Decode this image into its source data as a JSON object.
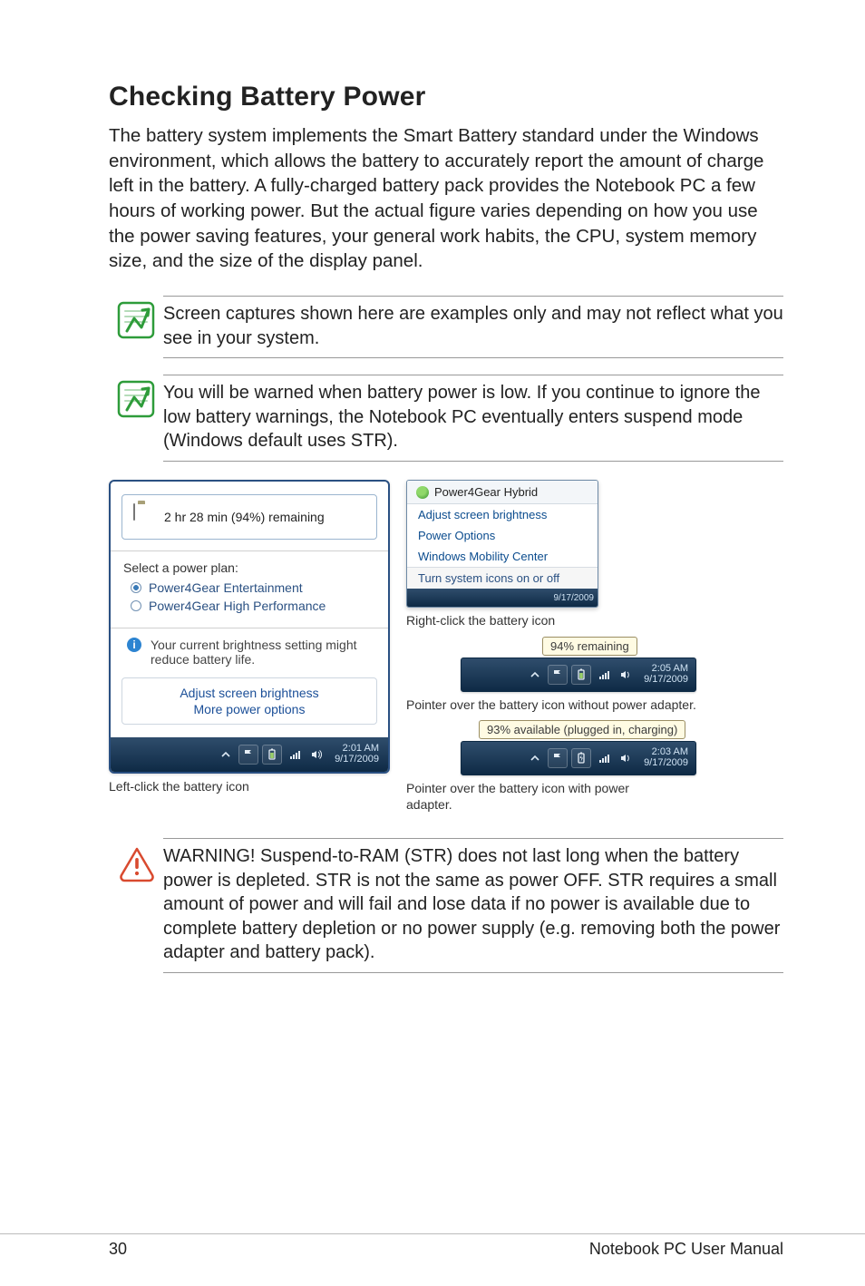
{
  "heading": "Checking Battery Power",
  "intro": "The battery system implements the Smart Battery standard under the Windows environment, which allows the battery to accurately report the amount of charge left in the battery. A fully-charged battery pack provides the Notebook PC a few hours of working power. But the actual figure varies depending on how you use the power saving features, your general work habits, the CPU, system memory size, and the size of the display panel.",
  "note1": "Screen captures shown here are examples only and may not reflect what you see in your system.",
  "note2": "You will be warned when battery power is low. If you continue to ignore the low battery warnings, the Notebook PC eventually enters suspend mode (Windows default uses STR).",
  "popup": {
    "remaining": "2 hr 28 min (94%) remaining",
    "select_label": "Select a power plan:",
    "plan1": "Power4Gear Entertainment",
    "plan2": "Power4Gear High Performance",
    "info_text": "Your current brightness setting might reduce battery life.",
    "link1": "Adjust screen brightness",
    "link2": "More power options",
    "clock_time": "2:01 AM",
    "clock_date": "9/17/2009"
  },
  "caption_left": "Left-click the battery icon",
  "ctx": {
    "title": "Power4Gear Hybrid",
    "i1": "Adjust screen brightness",
    "i2": "Power Options",
    "i3": "Windows Mobility Center",
    "i4": "Turn system icons on or off",
    "bar_date": "9/17/2009"
  },
  "caption_ctx": "Right-click the battery icon",
  "tip1": {
    "bubble": "94% remaining",
    "time": "2:05 AM",
    "date": "9/17/2009"
  },
  "caption_tip1": "Pointer over the battery icon without power adapter.",
  "tip2": {
    "bubble": "93% available (plugged in, charging)",
    "time": "2:03 AM",
    "date": "9/17/2009"
  },
  "caption_tip2": "Pointer over the battery icon with power adapter.",
  "warning": "WARNING!  Suspend-to-RAM (STR) does not last long when the battery power is depleted. STR is not the same as power OFF. STR requires a small amount of power and will fail and lose data if no power is available due to complete battery depletion or no power supply (e.g. removing both the power adapter and battery pack).",
  "footer_page": "30",
  "footer_title": "Notebook PC User Manual"
}
